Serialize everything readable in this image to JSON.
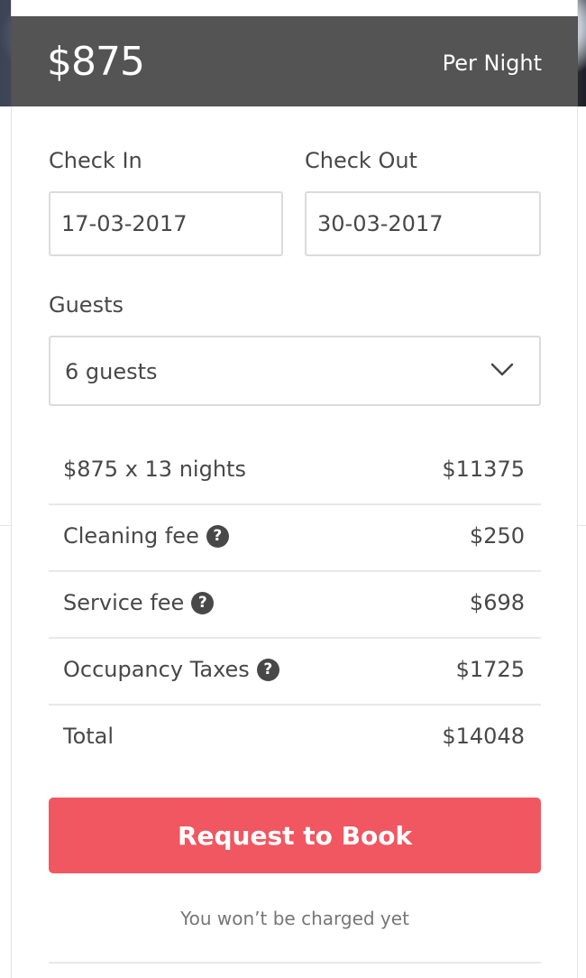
{
  "header": {
    "price": "$875",
    "unit": "Per Night"
  },
  "dates": {
    "check_in_label": "Check In",
    "check_in_value": "17-03-2017",
    "check_out_label": "Check Out",
    "check_out_value": "30-03-2017"
  },
  "guests": {
    "label": "Guests",
    "selected": "6 guests"
  },
  "pricing": [
    {
      "label": "$875 x 13 nights",
      "value": "$11375",
      "help": false
    },
    {
      "label": "Cleaning fee",
      "value": "$250",
      "help": true
    },
    {
      "label": "Service fee",
      "value": "$698",
      "help": true
    },
    {
      "label": "Occupancy Taxes",
      "value": "$1725",
      "help": true
    },
    {
      "label": "Total",
      "value": "$14048",
      "help": false
    }
  ],
  "help_icon_glyph": "?",
  "action": {
    "button_label": "Request to Book",
    "note": "You won’t be charged yet"
  },
  "colors": {
    "accent": "#f05761",
    "text": "#484848"
  },
  "icons": {
    "chevron": "chevron-down-icon",
    "help": "question-circle-icon"
  }
}
